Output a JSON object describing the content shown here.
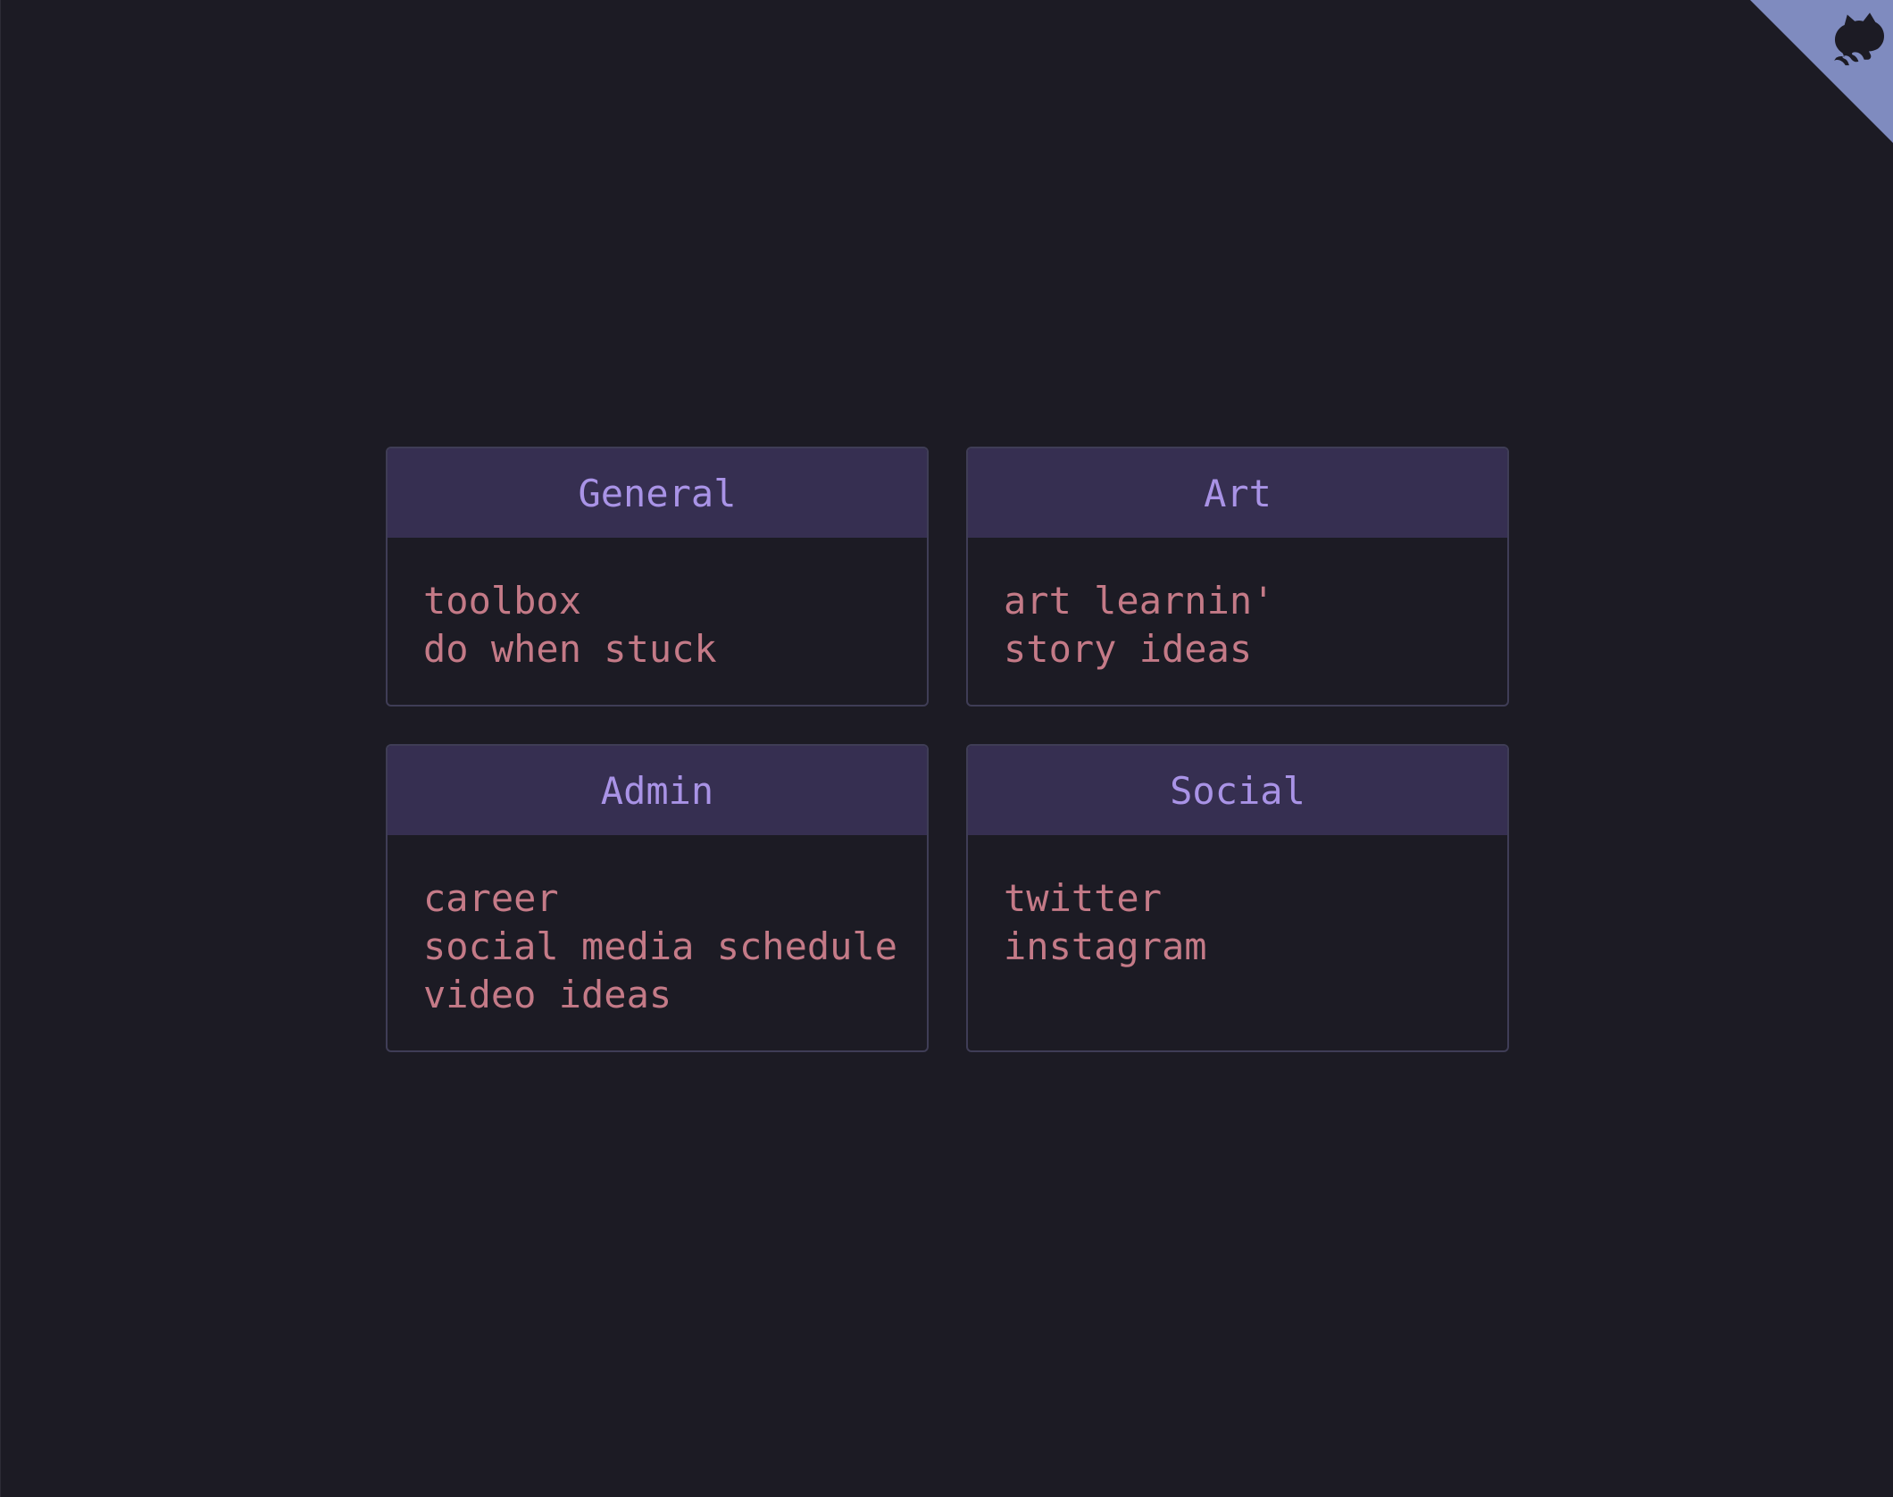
{
  "corner": {
    "icon": "github-octocat-icon",
    "color": "#7f8bbf"
  },
  "sections": [
    {
      "title": "General",
      "links": [
        "toolbox",
        "do when stuck"
      ]
    },
    {
      "title": "Art",
      "links": [
        "art learnin'",
        "story ideas"
      ]
    },
    {
      "title": "Admin",
      "links": [
        "career",
        "social media schedule",
        "video ideas"
      ]
    },
    {
      "title": "Social",
      "links": [
        "twitter",
        "instagram"
      ]
    }
  ],
  "colors": {
    "background": "#1c1b24",
    "header_bg": "#362f51",
    "header_text": "#a993e6",
    "link_text": "#c47a87",
    "border": "#3f3d56"
  }
}
